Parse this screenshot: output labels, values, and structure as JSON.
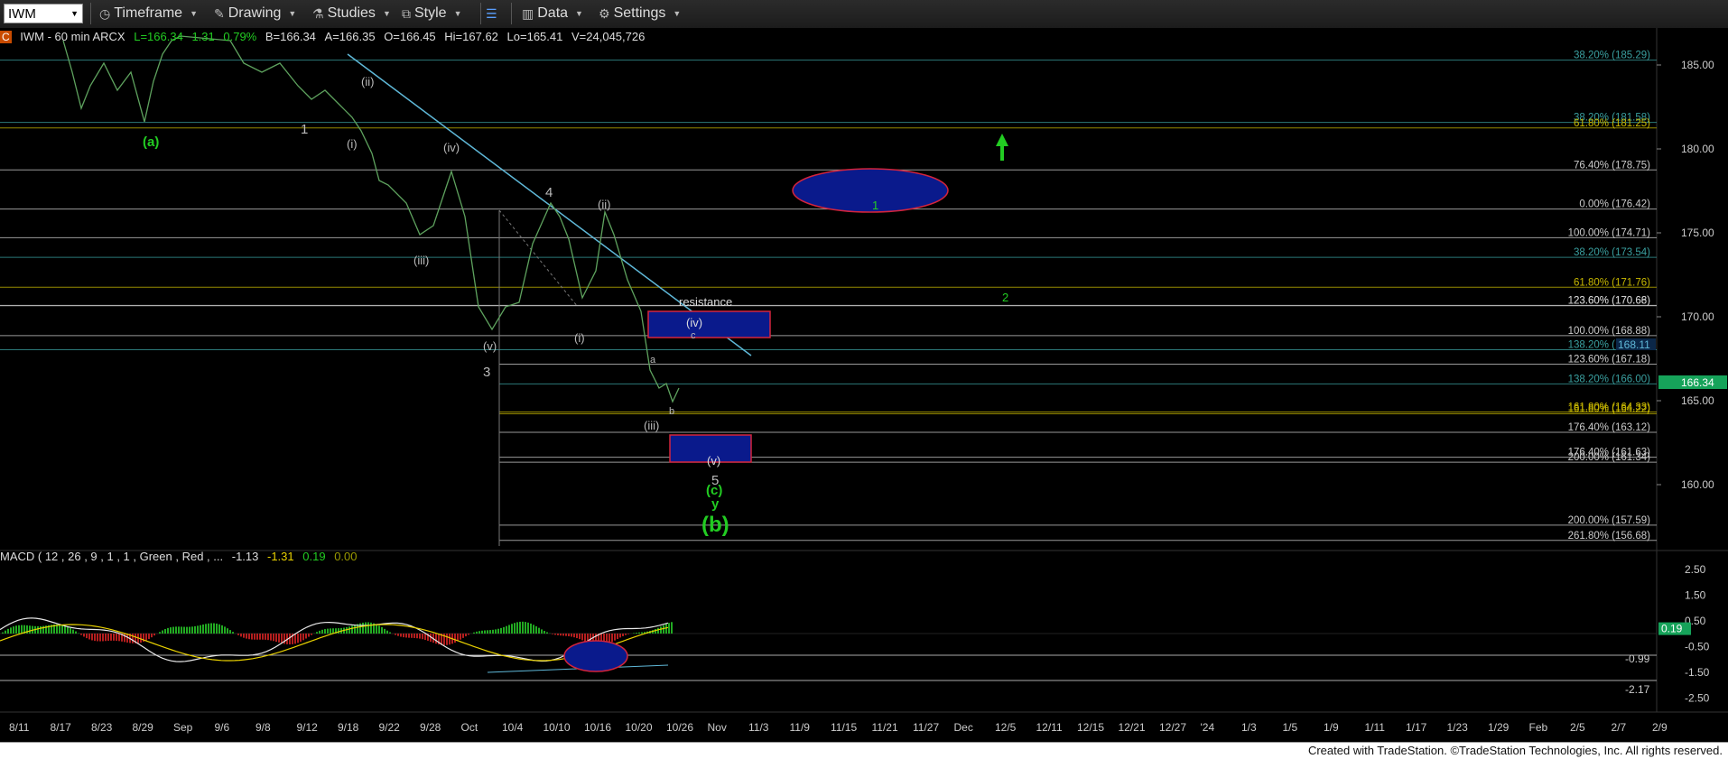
{
  "toolbar": {
    "symbol": "IWM",
    "timeframe": "Timeframe",
    "drawing": "Drawing",
    "studies": "Studies",
    "style": "Style",
    "data": "Data",
    "settings": "Settings"
  },
  "header": {
    "badge": "C",
    "title": "IWM - 60 min  ARCX",
    "last": "L=166.34",
    "change": "1.31",
    "change_pct": "0.79%",
    "bid": "B=166.34",
    "ask": "A=166.35",
    "open": "O=166.45",
    "high": "Hi=167.62",
    "low": "Lo=165.41",
    "volume": "V=24,045,726"
  },
  "macd_header": {
    "label": "MACD ( 12 , 26 , 9 , 1 , 1 , Green , Red , ...",
    "v1": "-1.13",
    "v2": "-1.31",
    "v3": "0.19",
    "v4": "0.00"
  },
  "price_axis": [
    "185.00",
    "180.00",
    "175.00",
    "170.00",
    "165.00",
    "160.00"
  ],
  "macd_axis": [
    "2.50",
    "1.50",
    "0.50",
    "-0.50",
    "-1.50",
    "-2.50"
  ],
  "last_price_tag": "166.34",
  "price_tag_2": "168.11",
  "macd_tags": [
    "0.19",
    "-0.99",
    "-2.17"
  ],
  "x_axis": [
    "8/11",
    "8/17",
    "8/23",
    "8/29",
    "Sep",
    "9/6",
    "9/8",
    "9/12",
    "9/18",
    "9/22",
    "9/28",
    "Oct",
    "10/4",
    "10/10",
    "10/16",
    "10/20",
    "10/26",
    "Nov",
    "11/3",
    "11/9",
    "11/15",
    "11/21",
    "11/27",
    "Dec",
    "12/5",
    "12/11",
    "12/15",
    "12/21",
    "12/27",
    "'24",
    "1/3",
    "1/5",
    "1/9",
    "1/11",
    "1/17",
    "1/23",
    "1/29",
    "Feb",
    "2/5",
    "2/7",
    "2/9"
  ],
  "fib_labels": [
    "38.20% (185.29)",
    "38.20% (181.58)",
    "61.80% (181.25)",
    "76.40% (178.75)",
    "0.00% (176.42)",
    "100.00% (174.71)",
    "38.20% (173.54)",
    "61.80% (171.76)",
    "123.60% (170.68)",
    "123.60% (170.66)",
    "100.00% (168.88)",
    "138.20% (168.04)",
    "123.60% (167.18)",
    "138.20% (166.00)",
    "161.80% (164.33)",
    "161.80% (164.22)",
    "176.40% (163.12)",
    "176.40% (161.63)",
    "200.00% (161.34)",
    "200.00% (157.59)",
    "261.80% (156.68)"
  ],
  "wave_labels": {
    "a_paren": "(a)",
    "w1": "1",
    "ii": "(ii)",
    "i": "(i)",
    "iv": "(iv)",
    "iii": "(iii)",
    "v": "(v)",
    "w3": "3",
    "w4": "4",
    "i2": "(i)",
    "ii2": "(ii)",
    "iv2": "(iv)",
    "c_small": "c",
    "a_small": "a",
    "b_small": "b",
    "iii2": "(iii)",
    "v2": "(v)",
    "w5": "5",
    "c_paren": "(c)",
    "y": "y",
    "b_paren": "(b)",
    "target1": "1",
    "target2": "2",
    "resistance": "resistance"
  },
  "footer": "Created with TradeStation. ©TradeStation Technologies, Inc. All rights reserved.",
  "colors": {
    "green": "#22cc22",
    "blue_fill": "#0a1a8c",
    "red_outline": "#d4243c",
    "trend": "#5fb8d8",
    "price": "#5ea25e"
  }
}
